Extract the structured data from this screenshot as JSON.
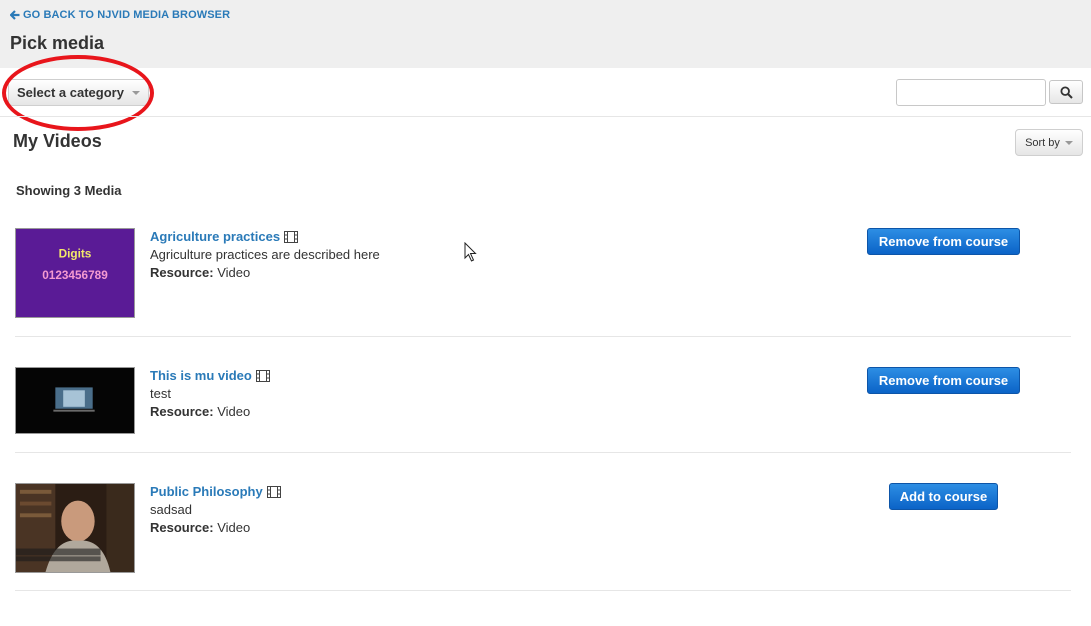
{
  "header": {
    "back_link": "GO BACK TO NJVID MEDIA BROWSER",
    "title": "Pick media"
  },
  "toolbar": {
    "category_label": "Select a category",
    "search_placeholder": "",
    "search_value": ""
  },
  "section": {
    "title": "My Videos",
    "sort_label": "Sort by",
    "showing": "Showing 3 Media"
  },
  "media": [
    {
      "title": "Agriculture practices",
      "description": "Agriculture practices are described here",
      "resource_label": "Resource:",
      "resource_type": "Video",
      "action_label": "Remove from course",
      "thumbnail": {
        "heading": "Digits",
        "digits": "0123456789",
        "icon": "digits-video-thumbnail"
      }
    },
    {
      "title": "This is mu video",
      "description": "test",
      "resource_label": "Resource:",
      "resource_type": "Video",
      "action_label": "Remove from course",
      "thumbnail": {
        "icon": "dark-video-thumbnail"
      }
    },
    {
      "title": "Public Philosophy",
      "description": "sadsad",
      "resource_label": "Resource:",
      "resource_type": "Video",
      "action_label": "Add to course",
      "thumbnail": {
        "icon": "interview-video-thumbnail"
      }
    }
  ],
  "colors": {
    "link": "#2a7ab8",
    "primary_button": "#0b63c7",
    "annotation_ring": "#e8151b",
    "header_band": "#efefef"
  },
  "icons": {
    "back": "arrow-left-icon",
    "search": "search-icon",
    "media_type": "film-icon",
    "pointer": "mouse-cursor-icon"
  }
}
